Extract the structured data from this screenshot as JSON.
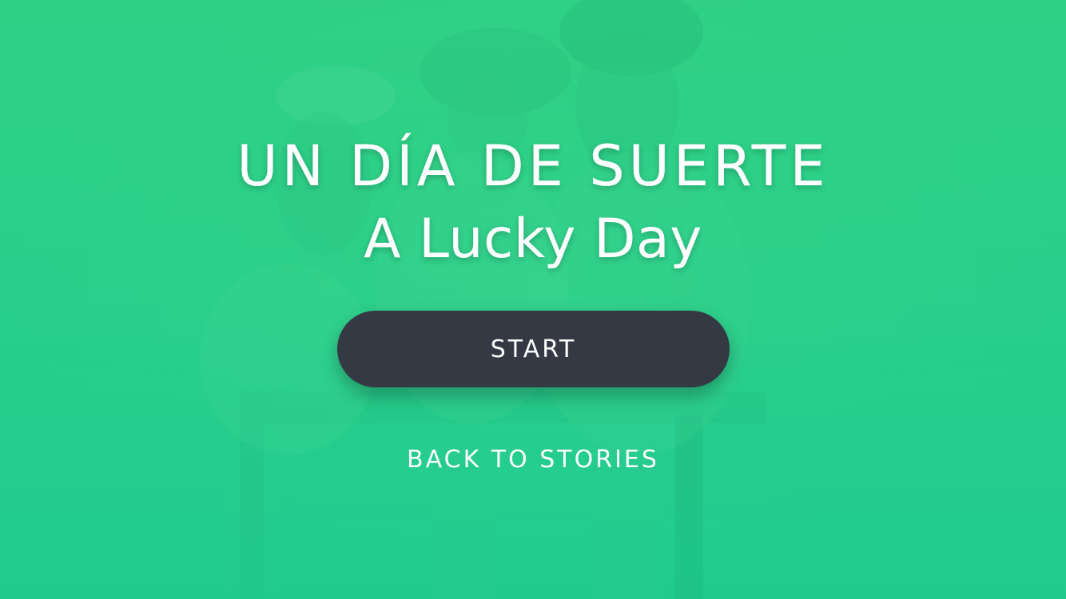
{
  "story": {
    "title": "UN DÍA DE SUERTE",
    "subtitle": "A Lucky Day"
  },
  "actions": {
    "start_label": "START",
    "back_label": "BACK TO STORIES"
  },
  "colors": {
    "background": "#2ccf8a",
    "button": "#353944",
    "text": "#ffffff"
  }
}
